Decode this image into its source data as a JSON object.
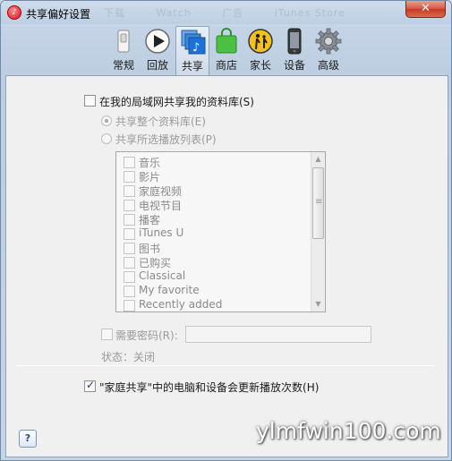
{
  "window": {
    "title": "共享偏好设置",
    "ghost_tabs": [
      "下载",
      "Watch",
      "广告",
      "iTunes Store"
    ],
    "close_glyph": "✕"
  },
  "toolbar": {
    "items": [
      {
        "label": "常规",
        "icon": "general-switch-icon"
      },
      {
        "label": "回放",
        "icon": "playback-icon"
      },
      {
        "label": "共享",
        "icon": "sharing-icon",
        "active": true
      },
      {
        "label": "商店",
        "icon": "store-bag-icon"
      },
      {
        "label": "家长",
        "icon": "parental-icon"
      },
      {
        "label": "设备",
        "icon": "device-iphone-icon"
      },
      {
        "label": "高级",
        "icon": "gear-icon"
      }
    ]
  },
  "sharing": {
    "share_library_label": "在我的局域网共享我的资料库(S)",
    "share_library_checked": false,
    "share_entire_label": "共享整个资料库(E)",
    "share_entire_selected": true,
    "share_selected_label": "共享所选播放列表(P)",
    "share_selected_selected": false,
    "playlists": [
      "音乐",
      "影片",
      "家庭视频",
      "电视节目",
      "播客",
      "iTunes U",
      "图书",
      "已购买",
      "Classical",
      "My favorite",
      "Recently added"
    ],
    "require_password_label": "需要密码(R):",
    "password_value": "",
    "status_label": "状态：关闭",
    "home_sharing_label": "\"家庭共享\"中的电脑和设备会更新播放次数(H)",
    "home_sharing_checked": true
  },
  "help_button": "?",
  "watermark": "ylmfwin100.com",
  "colors": {
    "accent": "#1d72d8",
    "window_frame": "#bccde0",
    "panel_bg": "#f0f0f0",
    "close_red": "#c63a22"
  }
}
